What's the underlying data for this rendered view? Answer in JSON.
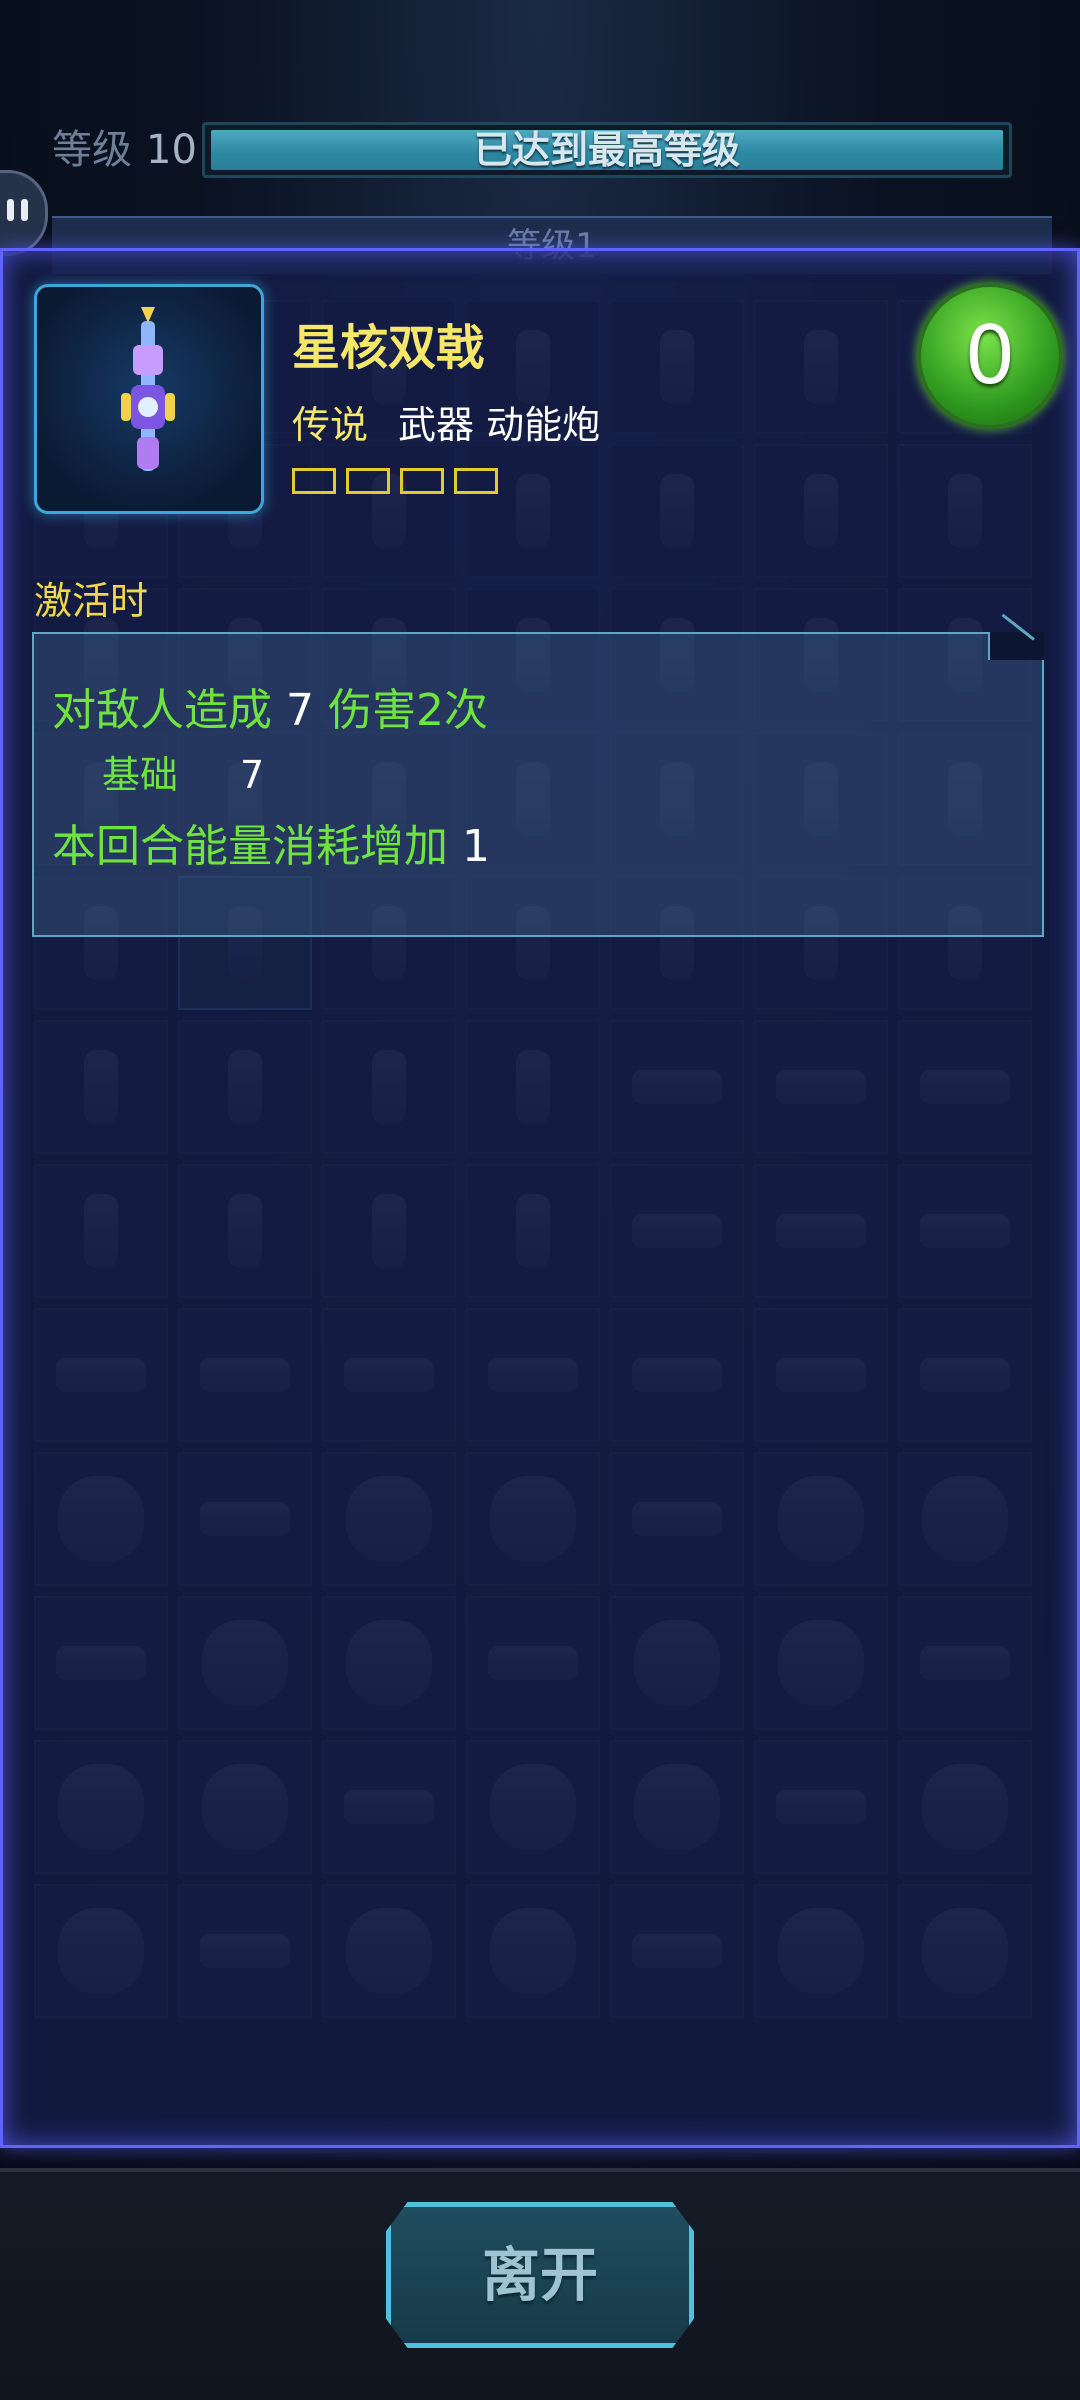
{
  "header": {
    "level_label": "等级",
    "level_value": "10",
    "level_bar_text": "已达到最高等级",
    "level_progress": 1.0
  },
  "collection": {
    "section_header": "等级1"
  },
  "item": {
    "name": "星核双戟",
    "rarity": "传说",
    "type": "武器 动能炮",
    "cost": "0",
    "upgrade_slots_total": 4,
    "upgrade_slots_filled": 0
  },
  "effect": {
    "trigger_label": "激活时",
    "line1_prefix": "对敌人造成",
    "line1_value": "7",
    "line1_suffix": "伤害2次",
    "base_label": "基础",
    "base_value": "7",
    "line3_text": "本回合能量消耗增加",
    "line3_value": "1"
  },
  "footer": {
    "leave_button": "离开"
  },
  "colors": {
    "panel_border": "#5f63ff",
    "legendary_yellow": "#f4e76a",
    "effect_green": "#6fe33e",
    "cost_green": "#2f9b1f",
    "button_cyan": "#4fc0de"
  }
}
